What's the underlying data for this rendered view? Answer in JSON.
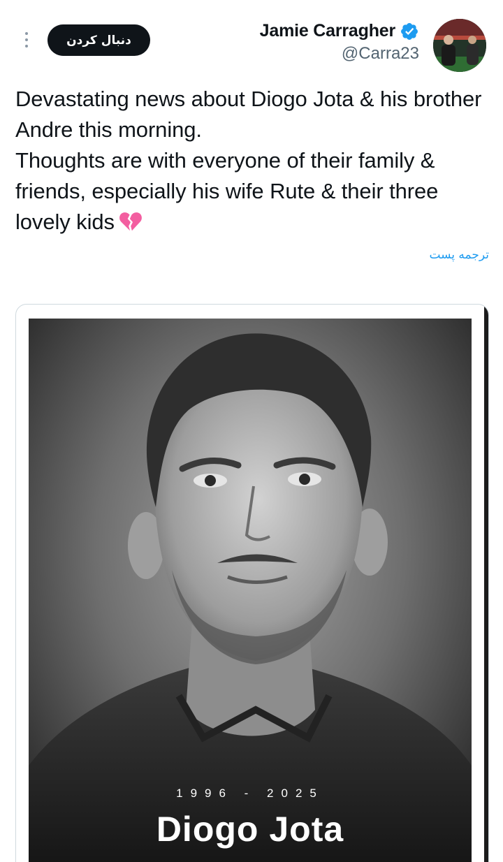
{
  "header": {
    "follow_label": "دنبال کردن",
    "author_name": "Jamie Carragher",
    "handle": "@Carra23",
    "verified_color": "#1d9bf0"
  },
  "tweet": {
    "text": "Devastating news about Diogo Jota & his brother Andre this morning.\nThoughts are with everyone of their family & friends, especially his wife Rute & their three lovely kids",
    "emoji": "broken-heart",
    "translate_label": "ترجمه پست"
  },
  "media": {
    "years": "1996 - 2025",
    "name": "Diogo Jota"
  },
  "icons": {
    "more": "more-vertical-icon",
    "verified": "verified-badge-icon",
    "emoji": "broken-heart-icon"
  }
}
